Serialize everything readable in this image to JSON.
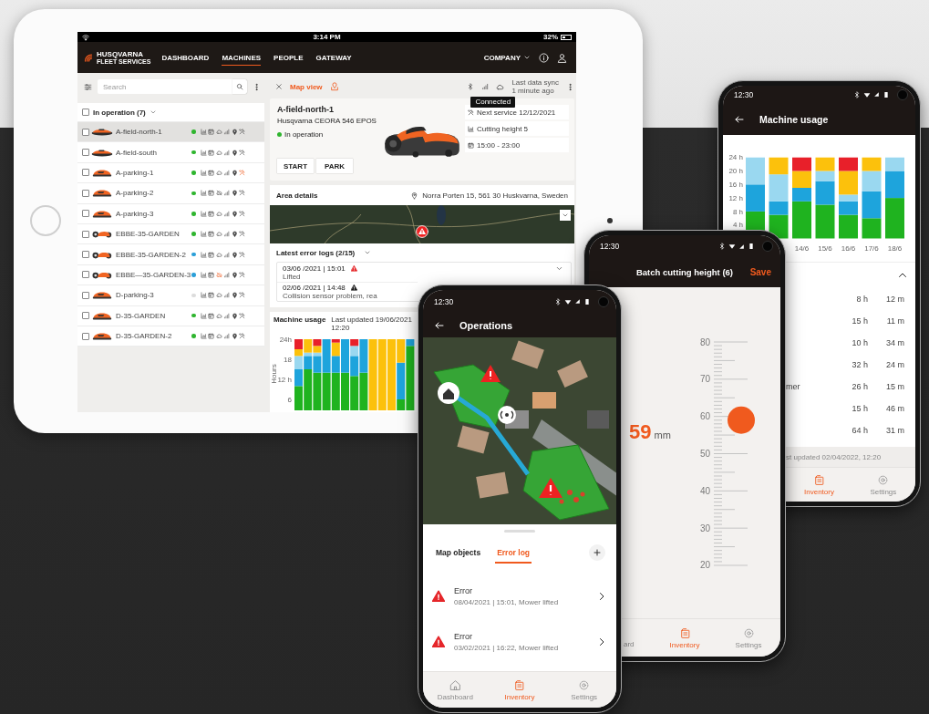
{
  "tablet": {
    "status_bar": {
      "time": "3:14 PM",
      "battery": "32%"
    },
    "brand": {
      "name": "HUSQVARNA",
      "tagline": "FLEET SERVICES"
    },
    "nav_tabs": [
      {
        "label": "DASHBOARD",
        "selected": false
      },
      {
        "label": "MACHINES",
        "selected": true
      },
      {
        "label": "PEOPLE",
        "selected": false
      },
      {
        "label": "GATEWAY",
        "selected": false
      }
    ],
    "company_menu": "COMPANY",
    "search": {
      "placeholder": "Search"
    },
    "group": {
      "label": "In operation (7)",
      "checked": false
    },
    "machines": [
      {
        "name": "A-field-north-1",
        "kind": "wide",
        "color": "#2fb52f",
        "checked": false,
        "selected": true,
        "cloud_offline": false,
        "cloud_alert": false,
        "service_alert": false
      },
      {
        "name": "A-field-south",
        "kind": "wide",
        "color": "#2fb52f",
        "checked": false,
        "selected": false,
        "cloud_offline": false,
        "cloud_alert": false,
        "service_alert": false
      },
      {
        "name": "A-parking-1",
        "kind": "standard",
        "color": "#2fb52f",
        "checked": false,
        "selected": false,
        "cloud_offline": false,
        "cloud_alert": false,
        "service_alert": true
      },
      {
        "name": "A-parking-2",
        "kind": "standard",
        "color": "#2fb52f",
        "checked": false,
        "selected": false,
        "cloud_offline": true,
        "cloud_alert": false,
        "service_alert": false
      },
      {
        "name": "A-parking-3",
        "kind": "standard",
        "color": "#2fb52f",
        "checked": false,
        "selected": false,
        "cloud_offline": false,
        "cloud_alert": false,
        "service_alert": false
      },
      {
        "name": "EBBE-35-GARDEN",
        "kind": "wheeled",
        "color": "#2fb52f",
        "checked": false,
        "selected": false,
        "cloud_offline": false,
        "cloud_alert": false,
        "service_alert": false
      },
      {
        "name": "EBBE-35-GARDEN-2",
        "kind": "wheeled",
        "color": "#2a9fd8",
        "checked": false,
        "selected": false,
        "cloud_offline": false,
        "cloud_alert": false,
        "service_alert": false
      },
      {
        "name": "EBBE—35-GARDEN-3",
        "kind": "wheeled",
        "color": "#2a9fd8",
        "checked": false,
        "selected": false,
        "cloud_offline": true,
        "cloud_alert": true,
        "service_alert": false
      },
      {
        "name": "D-parking-3",
        "kind": "standard",
        "color": "#dcdcdc",
        "checked": false,
        "selected": false,
        "cloud_offline": false,
        "cloud_alert": false,
        "service_alert": false
      },
      {
        "name": "D-35-GARDEN",
        "kind": "standard",
        "color": "#2fb52f",
        "checked": false,
        "selected": false,
        "cloud_offline": false,
        "cloud_alert": false,
        "service_alert": false
      },
      {
        "name": "D-35-GARDEN-2",
        "kind": "standard",
        "color": "#2fb52f",
        "checked": false,
        "selected": false,
        "cloud_offline": false,
        "cloud_alert": false,
        "service_alert": false
      }
    ],
    "detail": {
      "map_view": "Map view",
      "sync_label": "Last data sync",
      "sync_time": "1 minute ago",
      "tooltip": "Connected",
      "name": "A-field-north-1",
      "model": "Husqvarna CEORA 546 EPOS",
      "status": "In operation",
      "actions": [
        "START",
        "PARK"
      ],
      "info": [
        {
          "kind": "service",
          "text": "Next service 12/12/2021"
        },
        {
          "kind": "height",
          "text": "Cutting height 5"
        },
        {
          "kind": "schedule",
          "text": "15:00 - 23:00"
        }
      ]
    },
    "area": {
      "title": "Area details",
      "address": "Norra Porten 15, 561 30 Huskvarna, Sweden"
    },
    "error_logs": {
      "title": "Latest error logs (2/15)",
      "rows": [
        {
          "time": "03/06 /2021 | 15:01",
          "kind": "error",
          "message": "Lifted"
        },
        {
          "time": "02/06 /2021 | 14:48",
          "kind": "warning",
          "message": "Collision sensor problem, rea"
        }
      ]
    },
    "usage": {
      "title": "Machine usage",
      "updated": "Last updated 19/06/2021 12:20",
      "chart_data": {
        "type": "bar",
        "stacked": true,
        "ylabel": "Hours",
        "ylim": [
          0,
          24
        ],
        "yticks": [
          {
            "value": 6,
            "label": "6"
          },
          {
            "value": 12,
            "label": "12 h"
          },
          {
            "value": 18,
            "label": "18"
          },
          {
            "value": 24,
            "label": "24h"
          }
        ],
        "series": [
          {
            "color": "#1fb31f",
            "values": [
              10,
              15,
              14,
              14,
              14,
              14,
              13,
              14,
              0,
              0,
              0,
              6,
              22
            ]
          },
          {
            "color": "#1ea4dc",
            "values": [
              5,
              4,
              5,
              10,
              5,
              10,
              6,
              10,
              0,
              0,
              0,
              11,
              2
            ]
          },
          {
            "color": "#9ad8f0",
            "values": [
              4,
              1,
              1,
              0,
              0,
              0,
              3,
              0,
              0,
              0,
              0,
              0,
              0
            ]
          },
          {
            "color": "#fcc10c",
            "values": [
              2,
              4,
              2,
              0,
              4,
              0,
              0,
              0,
              24,
              24,
              24,
              7,
              0
            ]
          },
          {
            "color": "#e8202a",
            "values": [
              3,
              0,
              2,
              0,
              1,
              0,
              2,
              0,
              0,
              0,
              0,
              0,
              0
            ]
          }
        ]
      }
    }
  },
  "phone_usage": {
    "time": "12:30",
    "title": "Machine usage",
    "chart_data": {
      "type": "bar",
      "stacked": true,
      "categories": [
        null,
        null,
        "14/6",
        "15/6",
        "16/6",
        "17/6",
        "18/6"
      ],
      "ylim": [
        0,
        24
      ],
      "yticks": [
        {
          "value": 4,
          "label": "4 h"
        },
        {
          "value": 8,
          "label": "8 h"
        },
        {
          "value": 12,
          "label": "12 h"
        },
        {
          "value": 16,
          "label": "16 h"
        },
        {
          "value": 20,
          "label": "20 h"
        },
        {
          "value": 24,
          "label": "24 h"
        }
      ],
      "series": [
        {
          "color": "#1fb31f",
          "values": [
            8,
            7,
            11,
            10,
            7,
            6,
            12
          ]
        },
        {
          "color": "#1ea4dc",
          "values": [
            8,
            4,
            4,
            7,
            4,
            8,
            8
          ]
        },
        {
          "color": "#9ad8f0",
          "values": [
            8,
            8,
            0,
            3,
            2,
            6,
            4
          ]
        },
        {
          "color": "#fcc10c",
          "values": [
            0,
            5,
            5,
            4,
            7,
            4,
            0
          ]
        },
        {
          "color": "#e8202a",
          "values": [
            0,
            0,
            4,
            0,
            4,
            0,
            0
          ]
        }
      ]
    },
    "expanded": true,
    "rows": [
      {
        "hours": "8 h",
        "minutes": "12 m"
      },
      {
        "hours": "15 h",
        "minutes": "11 m"
      },
      {
        "hours": "10 h",
        "minutes": "34 m"
      },
      {
        "hours": "32 h",
        "minutes": "24 m"
      },
      {
        "label": "mer",
        "hours": "26 h",
        "minutes": "15 m"
      },
      {
        "hours": "15 h",
        "minutes": "46 m"
      },
      {
        "hours": "64 h",
        "minutes": "31 m"
      }
    ],
    "footer": "st updated 02/04/2022, 12:20",
    "nav": [
      {
        "label": "Inventory",
        "selected": true
      },
      {
        "label": "Settings",
        "selected": false
      }
    ]
  },
  "phone_height": {
    "time": "12:30",
    "title": "Batch cutting height (6)",
    "save": "Save",
    "value": "59",
    "unit": "mm",
    "scale": [
      "80",
      "70",
      "60",
      "50",
      "40",
      "30",
      "20"
    ],
    "level": 0.65,
    "nav": [
      {
        "label": "ard",
        "selected": false
      },
      {
        "label": "Inventory",
        "selected": true
      },
      {
        "label": "Settings",
        "selected": false
      }
    ]
  },
  "phone_operations": {
    "time": "12:30",
    "title": "Operations",
    "tabs": [
      {
        "label": "Map objects",
        "selected": false
      },
      {
        "label": "Error log",
        "selected": true
      }
    ],
    "errors": [
      {
        "title": "Error",
        "detail": "08/04/2021 | 15:01, Mower lifted"
      },
      {
        "title": "Error",
        "detail": "03/02/2021 | 16:22, Mower lifted"
      }
    ],
    "nav": [
      {
        "label": "Dashboard",
        "selected": false
      },
      {
        "label": "Inventory",
        "selected": true
      },
      {
        "label": "Settings",
        "selected": false
      }
    ]
  }
}
